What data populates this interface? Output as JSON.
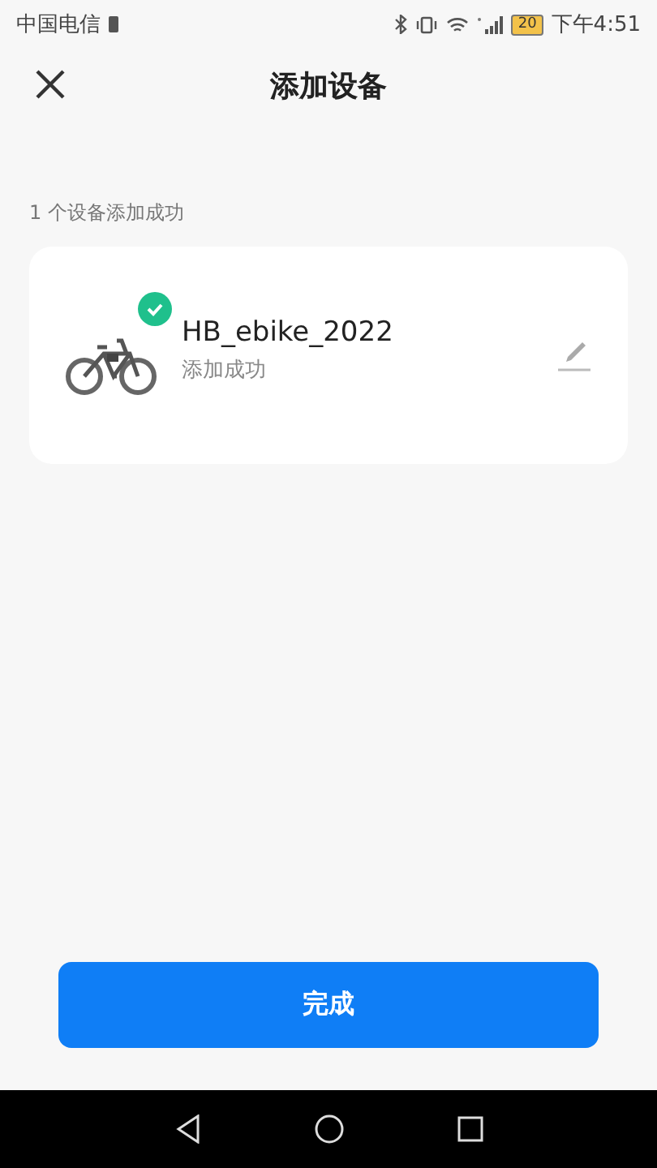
{
  "status_bar": {
    "carrier": "中国电信",
    "battery": "20",
    "time": "下午4:51"
  },
  "header": {
    "title": "添加设备"
  },
  "summary": "1 个设备添加成功",
  "devices": [
    {
      "name": "HB_ebike_2022",
      "status": "添加成功",
      "added": true
    }
  ],
  "done_button": "完成"
}
